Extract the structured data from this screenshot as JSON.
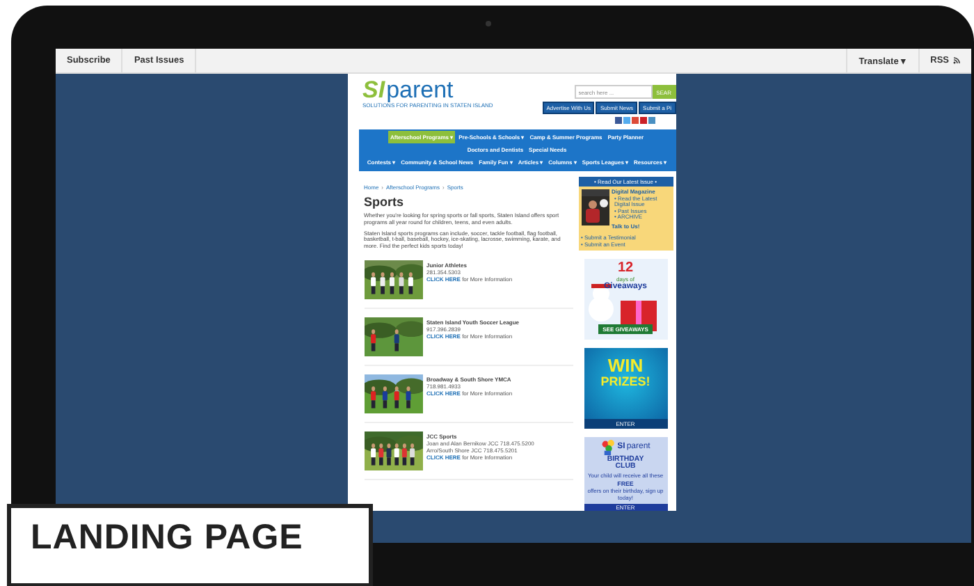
{
  "browser_bar": {
    "left": [
      "Subscribe",
      "Past Issues"
    ],
    "translate": "Translate ▾",
    "rss": "RSS"
  },
  "site": {
    "logo_bold": "SI",
    "logo_word": "parent",
    "tagline": "SOLUTIONS FOR PARENTING IN STATEN ISLAND",
    "search": {
      "placeholder": "search here ...",
      "button": "SEAR"
    },
    "header_links": [
      "Advertise With Us",
      "Submit News",
      "Submit a Pi"
    ],
    "social": [
      {
        "color": "#3b5998"
      },
      {
        "color": "#55acee"
      },
      {
        "color": "#dd4b39"
      },
      {
        "color": "#cb2027"
      },
      {
        "color": "#4a90c2"
      }
    ],
    "nav_rows": [
      [
        {
          "label": "Afterschool Programs ▾",
          "selected": true
        },
        {
          "label": "Pre-Schools & Schools ▾",
          "selected": false
        },
        {
          "label": "Camp & Summer Programs",
          "selected": false
        },
        {
          "label": "Party Planner",
          "selected": false
        }
      ],
      [
        {
          "label": "Doctors and Dentists",
          "selected": false
        },
        {
          "label": "Special Needs",
          "selected": false
        }
      ],
      [
        {
          "label": "Contests ▾",
          "selected": false
        },
        {
          "label": "Community & School News",
          "selected": false
        },
        {
          "label": "Family Fun ▾",
          "selected": false
        },
        {
          "label": "Articles ▾",
          "selected": false
        },
        {
          "label": "Columns ▾",
          "selected": false
        },
        {
          "label": "Sports Leagues ▾",
          "selected": false
        },
        {
          "label": "Resources ▾",
          "selected": false
        }
      ]
    ],
    "breadcrumb": [
      "Home",
      "Afterschool Programs",
      "Sports"
    ],
    "breadcrumb_separator": "›",
    "heading": "Sports",
    "paragraphs": [
      "Whether you're looking for spring sports or fall sports, Staten Island offers sport programs all year round for children, teens, and even adults.",
      "Staten Island sports programs can include, soccer, tackle football, flag football, basketball, t-ball, baseball, hockey, ice-skating, lacrosse, swimming, karate, and more. Find the perfect kids sports today!"
    ],
    "listings": [
      {
        "name": "Junior Athletes",
        "lines": [
          "281.354.5303"
        ],
        "link": "CLICK HERE",
        "link_rest": "for More Information"
      },
      {
        "name": "Staten Island Youth Soccer League",
        "lines": [
          "917.396.2839"
        ],
        "link": "CLICK HERE",
        "link_rest": "for More Information"
      },
      {
        "name": "Broadway & South Shore YMCA",
        "lines": [
          "718.981.4933"
        ],
        "link": "CLICK HERE",
        "link_rest": "for More Information"
      },
      {
        "name": "JCC Sports",
        "lines": [
          "Joan and Alan Bernikow JCC 718.475.5200",
          "Arro/South Shore JCC 718.475.5201"
        ],
        "link": "CLICK HERE",
        "link_rest": "for More Information"
      }
    ],
    "sidebar": {
      "title": "• Read Our Latest Issue •",
      "heading": "Digital Magazine",
      "links": [
        "• Read the Latest",
        "Digital Issue",
        "• Past Issues",
        "• ARCHIVE"
      ],
      "talk": "Talk to Us!",
      "bottom_links": [
        "• Submit a Testimonial",
        "• Submit an Event"
      ]
    },
    "ads": [
      {
        "kind": "giveaway",
        "big": "12",
        "line": "days of",
        "title": "Giveaways",
        "button": "SEE GIVEAWAYS"
      },
      {
        "kind": "prizes",
        "title": "WIN",
        "title2": "PRIZES!",
        "button": "ENTER"
      },
      {
        "kind": "birthday",
        "brand_bold": "SI",
        "brand": "parent",
        "title": "BIRTHDAY CLUB",
        "text": "Your child will receive all these",
        "free": "FREE",
        "text2": "offers on their birthday, sign up today!",
        "button": "ENTER"
      }
    ]
  },
  "label": "LANDING PAGE"
}
